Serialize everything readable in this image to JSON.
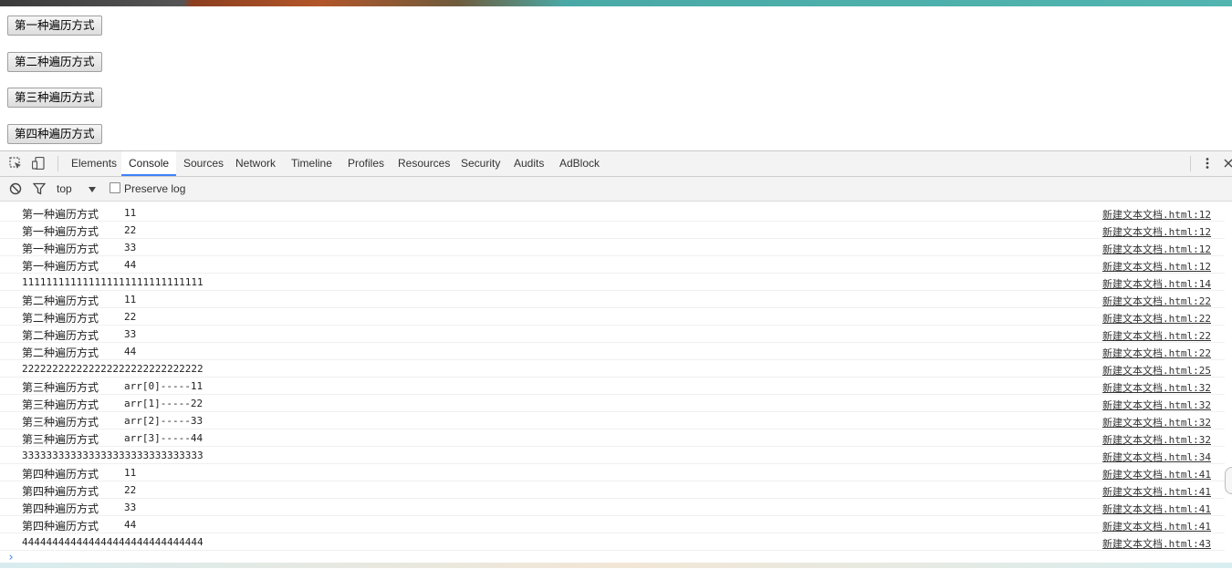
{
  "page": {
    "buttons": [
      "第一种遍历方式",
      "第二种遍历方式",
      "第三种遍历方式",
      "第四种遍历方式"
    ]
  },
  "devtools": {
    "tabs": [
      "Elements",
      "Console",
      "Sources",
      "Network",
      "Timeline",
      "Profiles",
      "Resources",
      "Security",
      "Audits",
      "AdBlock"
    ],
    "active_tab": "Console",
    "filter": {
      "context": "top",
      "preserve_log_label": "Preserve log"
    },
    "accent_color": "#3e82f7",
    "icons": [
      "inspect-element-icon",
      "device-mode-icon",
      "clear-console-icon",
      "filter-icon",
      "dropdown-arrow-icon",
      "kebab-menu-icon",
      "close-icon",
      "prompt-chevron-icon"
    ]
  },
  "console": {
    "rows": [
      {
        "label": "第一种遍历方式",
        "value": "11",
        "source": "新建文本文档.html:12"
      },
      {
        "label": "第一种遍历方式",
        "value": "22",
        "source": "新建文本文档.html:12"
      },
      {
        "label": "第一种遍历方式",
        "value": "33",
        "source": "新建文本文档.html:12"
      },
      {
        "label": "第一种遍历方式",
        "value": "44",
        "source": "新建文本文档.html:12"
      },
      {
        "label": "",
        "value": "111111111111111111111111111111",
        "source": "新建文本文档.html:14"
      },
      {
        "label": "第二种遍历方式",
        "value": "11",
        "source": "新建文本文档.html:22"
      },
      {
        "label": "第二种遍历方式",
        "value": "22",
        "source": "新建文本文档.html:22"
      },
      {
        "label": "第二种遍历方式",
        "value": "33",
        "source": "新建文本文档.html:22"
      },
      {
        "label": "第二种遍历方式",
        "value": "44",
        "source": "新建文本文档.html:22"
      },
      {
        "label": "",
        "value": "222222222222222222222222222222",
        "source": "新建文本文档.html:25"
      },
      {
        "label": "第三种遍历方式",
        "value": "arr[0]-----11",
        "source": "新建文本文档.html:32"
      },
      {
        "label": "第三种遍历方式",
        "value": "arr[1]-----22",
        "source": "新建文本文档.html:32"
      },
      {
        "label": "第三种遍历方式",
        "value": "arr[2]-----33",
        "source": "新建文本文档.html:32"
      },
      {
        "label": "第三种遍历方式",
        "value": "arr[3]-----44",
        "source": "新建文本文档.html:32"
      },
      {
        "label": "",
        "value": "333333333333333333333333333333",
        "source": "新建文本文档.html:34"
      },
      {
        "label": "第四种遍历方式",
        "value": "11",
        "source": "新建文本文档.html:41"
      },
      {
        "label": "第四种遍历方式",
        "value": "22",
        "source": "新建文本文档.html:41"
      },
      {
        "label": "第四种遍历方式",
        "value": "33",
        "source": "新建文本文档.html:41"
      },
      {
        "label": "第四种遍历方式",
        "value": "44",
        "source": "新建文本文档.html:41"
      },
      {
        "label": "",
        "value": "444444444444444444444444444444",
        "source": "新建文本文档.html:43"
      }
    ],
    "prompt": "›"
  }
}
